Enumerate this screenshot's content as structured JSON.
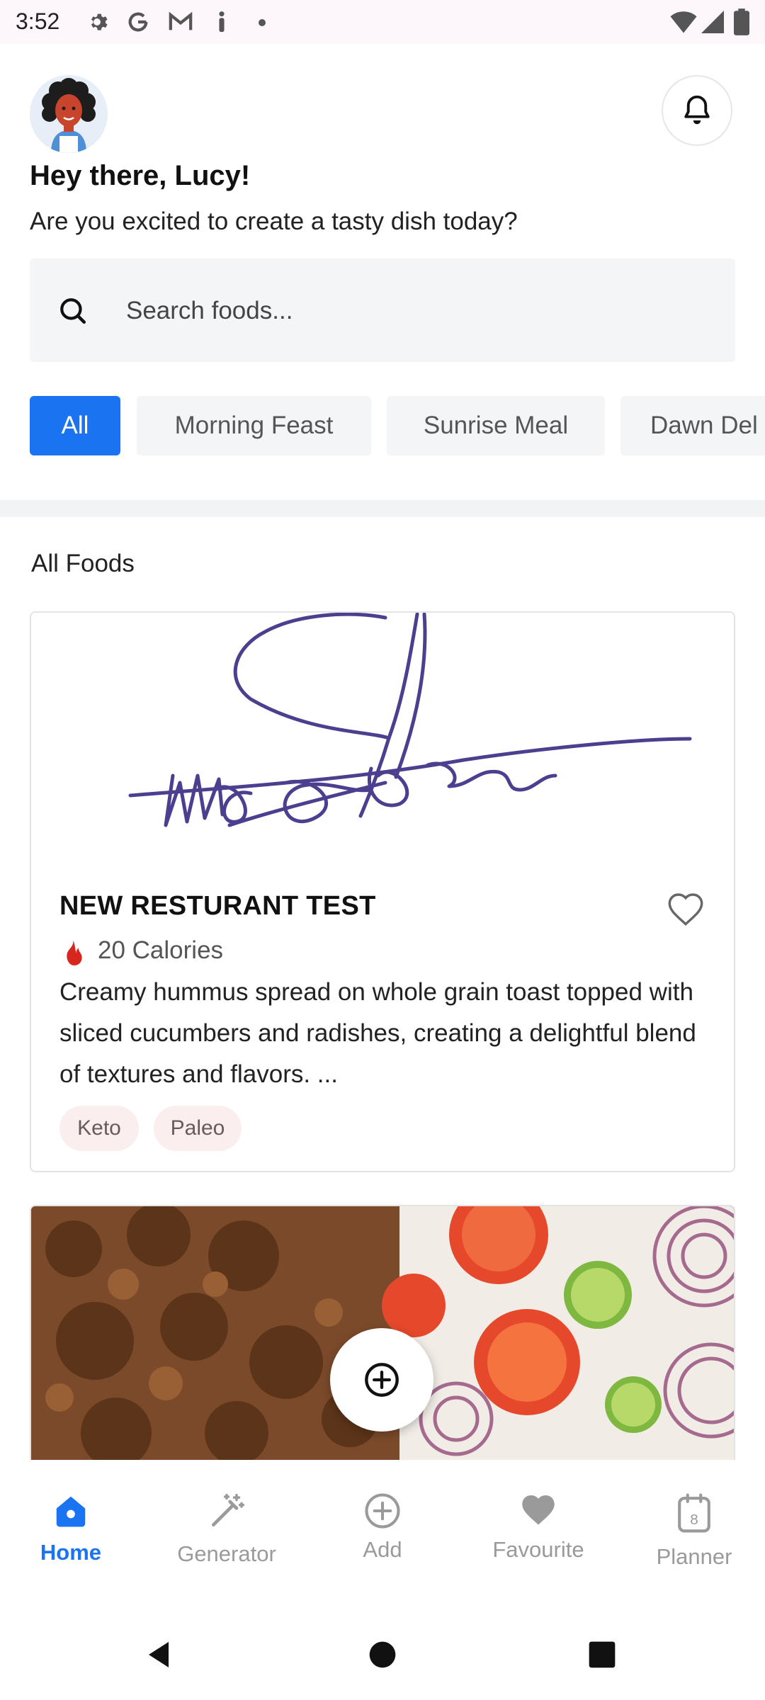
{
  "status_bar": {
    "time": "3:52"
  },
  "header": {
    "greeting": "Hey there, Lucy!",
    "subtitle": "Are you excited to create a tasty dish today?"
  },
  "search": {
    "placeholder": "Search foods..."
  },
  "categories": [
    "All",
    "Morning Feast",
    "Sunrise Meal",
    "Dawn Del"
  ],
  "section_title": "All Foods",
  "cards": [
    {
      "title": "NEW RESTURANT TEST",
      "calories": "20 Calories",
      "description": "Creamy hummus spread on whole grain toast topped with sliced cucumbers and radishes, creating a delightful blend of textures and flavors. ...",
      "tags": [
        "Keto",
        "Paleo"
      ]
    }
  ],
  "bottom_nav": {
    "items": [
      "Home",
      "Generator",
      "Add",
      "Favourite",
      "Planner"
    ],
    "planner_date": "8"
  },
  "colors": {
    "accent": "#1a73f0",
    "flame": "#d7261e",
    "tag_bg": "#fbeeee"
  }
}
